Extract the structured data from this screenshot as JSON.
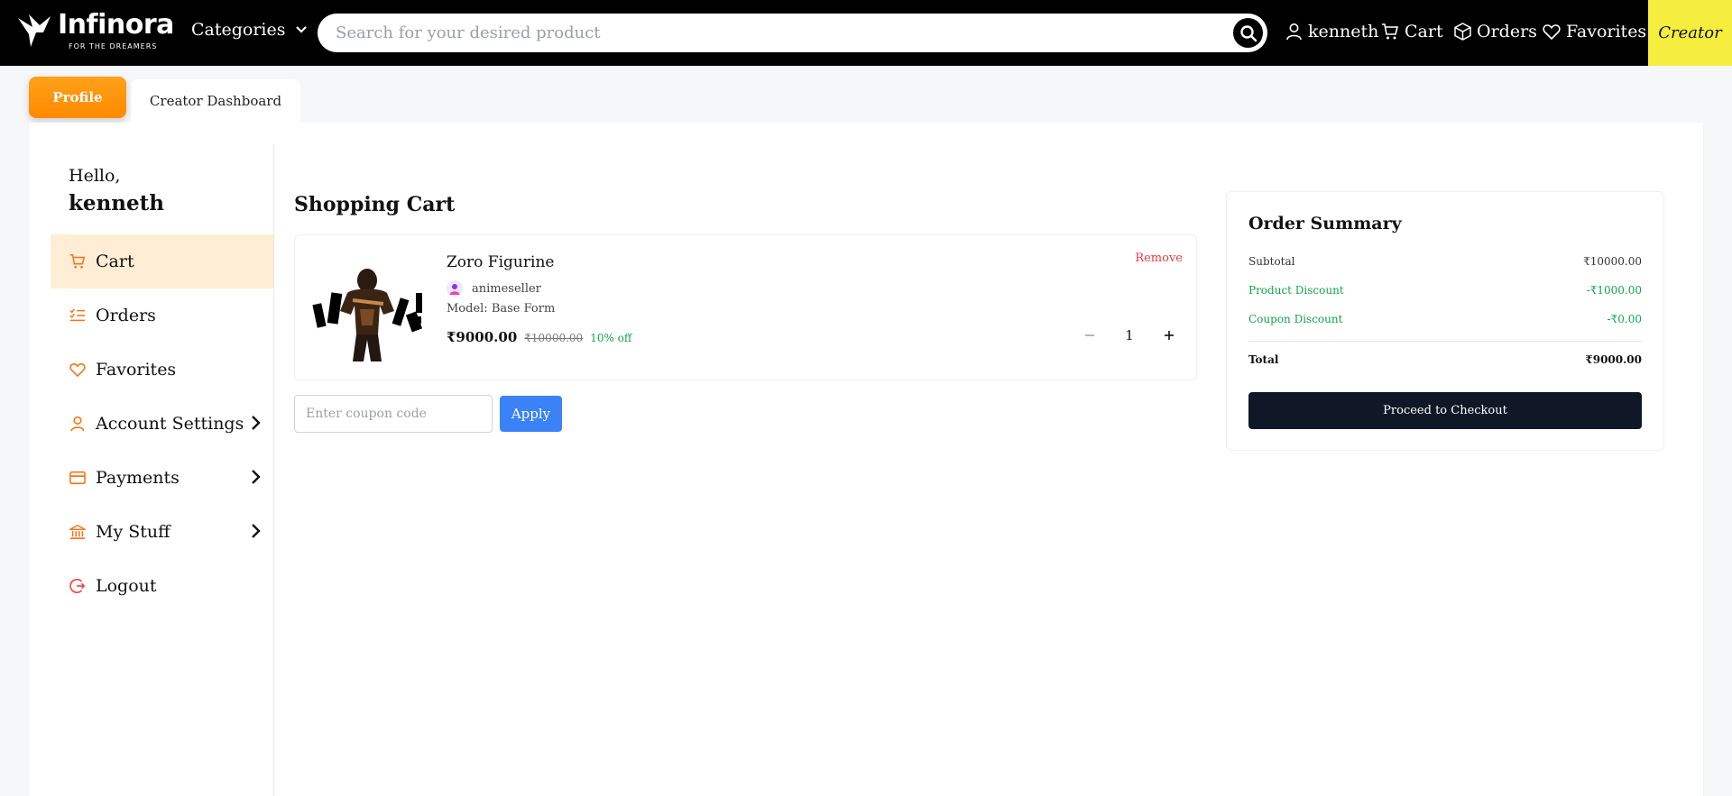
{
  "header": {
    "brand": "Infinora",
    "tagline": "FOR THE DREAMERS",
    "categories_label": "Categories",
    "search_placeholder": "Search for your desired product",
    "user_label": "kenneth",
    "cart_label": "Cart",
    "orders_label": "Orders",
    "favorites_label": "Favorites",
    "creator_label": "Creator"
  },
  "tabs": {
    "profile": "Profile",
    "creator_dashboard": "Creator Dashboard"
  },
  "sidebar": {
    "greeting": "Hello,",
    "username": "kenneth",
    "items": [
      {
        "label": "Cart",
        "icon": "cart-icon",
        "active": true
      },
      {
        "label": "Orders",
        "icon": "list-icon"
      },
      {
        "label": "Favorites",
        "icon": "heart-icon"
      },
      {
        "label": "Account Settings",
        "icon": "user-icon",
        "expandable": true
      },
      {
        "label": "Payments",
        "icon": "card-icon",
        "expandable": true
      },
      {
        "label": "My Stuff",
        "icon": "bank-icon",
        "expandable": true
      },
      {
        "label": "Logout",
        "icon": "logout-icon"
      }
    ]
  },
  "cart": {
    "title": "Shopping Cart",
    "item": {
      "name": "Zoro Figurine",
      "seller": "animeseller",
      "model": "Model: Base Form",
      "price": "₹9000.00",
      "mrp": "₹10000.00",
      "discount": "10% off",
      "remove_label": "Remove",
      "quantity": "1"
    },
    "coupon_placeholder": "Enter coupon code",
    "apply_label": "Apply"
  },
  "summary": {
    "title": "Order Summary",
    "subtotal_label": "Subtotal",
    "subtotal_value": "₹10000.00",
    "product_discount_label": "Product Discount",
    "product_discount_value": "-₹1000.00",
    "coupon_discount_label": "Coupon Discount",
    "coupon_discount_value": "-₹0.00",
    "total_label": "Total",
    "total_value": "₹9000.00",
    "checkout_label": "Proceed to Checkout"
  },
  "colors": {
    "accent_orange": "#ff8a00",
    "active_bg": "#ffedd5",
    "apply_blue": "#3b82f6",
    "checkout_dark": "#101828",
    "creator_yellow": "#f6ee3f",
    "discount_green": "#16a34a",
    "remove_red": "#e53e3e"
  }
}
